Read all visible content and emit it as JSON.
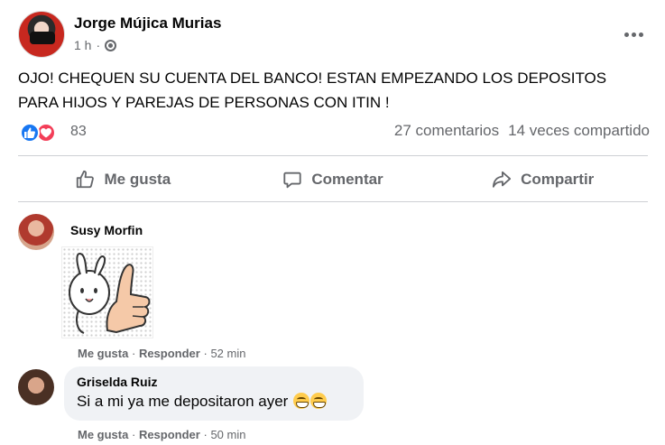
{
  "post": {
    "author": "Jorge Mújica Murias",
    "time": "1 h",
    "time_sep": "·",
    "text_line1": "OJO! CHEQUEN SU CUENTA DEL BANCO! ESTAN EMPEZANDO LOS DEPOSITOS",
    "text_line2": "PARA HIJOS Y PAREJAS DE PERSONAS CON ITIN !",
    "reaction_count": "83",
    "comments_count": "27 comentarios",
    "shares_count": "14 veces compartido",
    "icons": {
      "privacy": "globe-icon",
      "menu": "more-options-icon",
      "reactions": [
        "like-reaction-icon",
        "love-reaction-icon"
      ]
    },
    "colors": {
      "like": "#1877f2",
      "love": "#f33e58",
      "secondary_text": "#65676b"
    }
  },
  "actions": {
    "like": "Me gusta",
    "comment": "Comentar",
    "share": "Compartir"
  },
  "comments": [
    {
      "author": "Susy Morfin",
      "has_sticker": true,
      "like": "Me gusta",
      "reply": "Responder",
      "time": "52 min"
    },
    {
      "author": "Griselda Ruiz",
      "text": "Si a mi ya me depositaron ayer",
      "like": "Me gusta",
      "reply": "Responder",
      "time": "50 min"
    }
  ],
  "sep": "·"
}
